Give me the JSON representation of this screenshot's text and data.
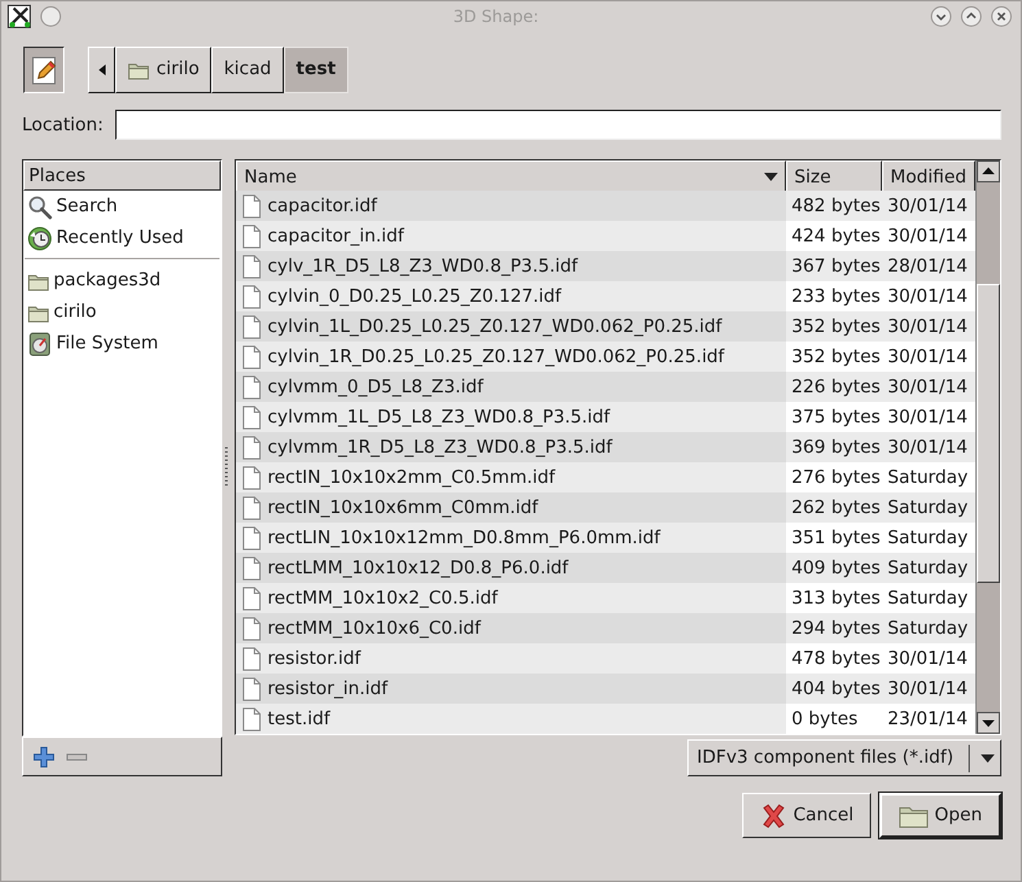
{
  "window": {
    "title": "3D Shape:"
  },
  "path_bar": {
    "segments": [
      {
        "label": "cirilo",
        "selected": false,
        "kind": "folder"
      },
      {
        "label": "kicad",
        "selected": false,
        "kind": "plain"
      },
      {
        "label": "test",
        "selected": true,
        "kind": "plain"
      }
    ]
  },
  "location": {
    "label": "Location:"
  },
  "places": {
    "header": "Places",
    "items": [
      {
        "label": "Search",
        "kind": "search"
      },
      {
        "label": "Recently Used",
        "kind": "recent"
      },
      {
        "label": "packages3d",
        "kind": "folder"
      },
      {
        "label": "cirilo",
        "kind": "folder"
      },
      {
        "label": "File System",
        "kind": "drive"
      }
    ]
  },
  "files": {
    "columns": [
      {
        "label": "Name",
        "sorted": true
      },
      {
        "label": "Size",
        "sorted": false
      },
      {
        "label": "Modified",
        "sorted": false
      }
    ],
    "rows": [
      {
        "name": "capacitor.idf",
        "size": "482 bytes",
        "modified": "30/01/14"
      },
      {
        "name": "capacitor_in.idf",
        "size": "424 bytes",
        "modified": "30/01/14"
      },
      {
        "name": "cylv_1R_D5_L8_Z3_WD0.8_P3.5.idf",
        "size": "367 bytes",
        "modified": "28/01/14"
      },
      {
        "name": "cylvin_0_D0.25_L0.25_Z0.127.idf",
        "size": "233 bytes",
        "modified": "30/01/14"
      },
      {
        "name": "cylvin_1L_D0.25_L0.25_Z0.127_WD0.062_P0.25.idf",
        "size": "352 bytes",
        "modified": "30/01/14"
      },
      {
        "name": "cylvin_1R_D0.25_L0.25_Z0.127_WD0.062_P0.25.idf",
        "size": "352 bytes",
        "modified": "30/01/14"
      },
      {
        "name": "cylvmm_0_D5_L8_Z3.idf",
        "size": "226 bytes",
        "modified": "30/01/14"
      },
      {
        "name": "cylvmm_1L_D5_L8_Z3_WD0.8_P3.5.idf",
        "size": "375 bytes",
        "modified": "30/01/14"
      },
      {
        "name": "cylvmm_1R_D5_L8_Z3_WD0.8_P3.5.idf",
        "size": "369 bytes",
        "modified": "30/01/14"
      },
      {
        "name": "rectIN_10x10x2mm_C0.5mm.idf",
        "size": "276 bytes",
        "modified": "Saturday"
      },
      {
        "name": "rectIN_10x10x6mm_C0mm.idf",
        "size": "262 bytes",
        "modified": "Saturday"
      },
      {
        "name": "rectLIN_10x10x12mm_D0.8mm_P6.0mm.idf",
        "size": "351 bytes",
        "modified": "Saturday"
      },
      {
        "name": "rectLMM_10x10x12_D0.8_P6.0.idf",
        "size": "409 bytes",
        "modified": "Saturday"
      },
      {
        "name": "rectMM_10x10x2_C0.5.idf",
        "size": "313 bytes",
        "modified": "Saturday"
      },
      {
        "name": "rectMM_10x10x6_C0.idf",
        "size": "294 bytes",
        "modified": "Saturday"
      },
      {
        "name": "resistor.idf",
        "size": "478 bytes",
        "modified": "30/01/14"
      },
      {
        "name": "resistor_in.idf",
        "size": "404 bytes",
        "modified": "30/01/14"
      },
      {
        "name": "test.idf",
        "size": "0 bytes",
        "modified": "23/01/14"
      }
    ]
  },
  "filter": {
    "value": "IDFv3 component files (*.idf)"
  },
  "buttons": [
    {
      "label": "Cancel",
      "kind": "cancel"
    },
    {
      "label": "Open",
      "kind": "open"
    }
  ]
}
